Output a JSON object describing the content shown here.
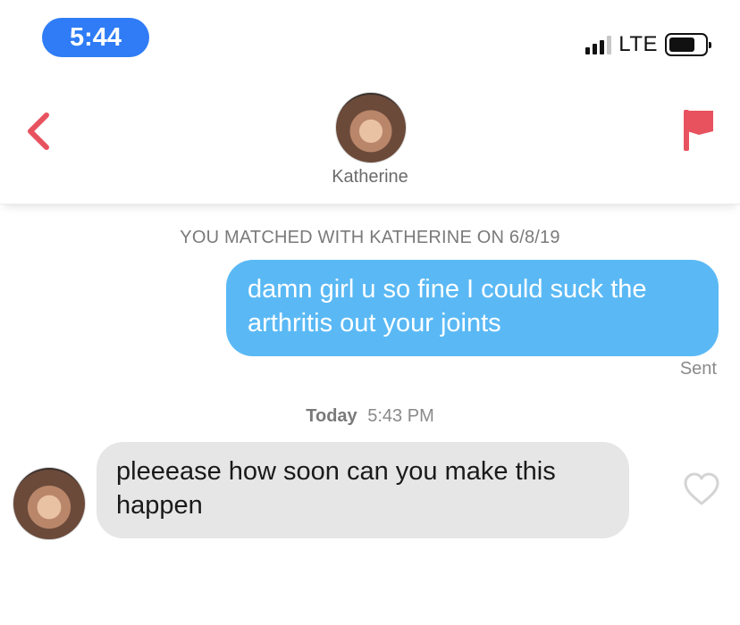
{
  "status_bar": {
    "time": "5:44",
    "network": "LTE"
  },
  "header": {
    "name": "Katherine",
    "back_icon": "chevron-left-icon",
    "flag_icon": "flag-icon",
    "accent_color": "#e8525f"
  },
  "chat": {
    "match_notice": "YOU MATCHED WITH KATHERINE ON 6/8/19",
    "outgoing": {
      "text": "damn girl u so fine I could suck the arthritis out your joints",
      "status": "Sent",
      "bubble_color": "#5ab9f5"
    },
    "timestamp": {
      "day": "Today",
      "time": "5:43 PM"
    },
    "incoming": {
      "text": "pleeease how soon can you make this happen",
      "bubble_color": "#e6e6e6",
      "like_icon": "heart-outline-icon"
    }
  }
}
